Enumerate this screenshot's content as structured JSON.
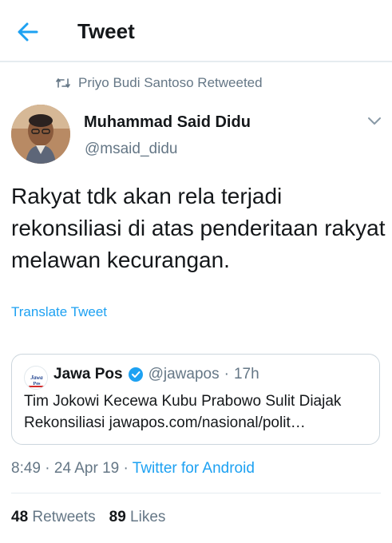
{
  "header": {
    "title": "Tweet"
  },
  "retweet": {
    "text": "Priyo Budi Santoso Retweeted"
  },
  "author": {
    "name": "Muhammad Said Didu",
    "handle": "@msaid_didu"
  },
  "tweet": {
    "text": "Rakyat tdk akan rela terjadi rekonsiliasi di atas penderitaan rakyat melawan kecurangan.",
    "translate_label": "Translate Tweet"
  },
  "quote": {
    "name": "Jawa Pos",
    "handle": "@jawapos",
    "separator": "·",
    "time": "17h",
    "line1": "Tim Jokowi Kecewa Kubu Prabowo Sulit Diajak",
    "line2": "Rekonsiliasi jawapos.com/nasional/polit…",
    "logo_text": "Jawa Pos"
  },
  "meta": {
    "time": "8:49",
    "sep1": "·",
    "date": "24 Apr 19",
    "sep2": "·",
    "source": "Twitter for Android"
  },
  "stats": {
    "retweets_count": "48",
    "retweets_label": "Retweets",
    "likes_count": "89",
    "likes_label": "Likes"
  },
  "colors": {
    "accent": "#1da1f2",
    "secondary_text": "#657786",
    "border": "#e6ecf0",
    "verified": "#1da1f2"
  },
  "icons": {
    "back": "arrow-left-icon",
    "retweet": "retweet-icon",
    "caret": "chevron-down-icon",
    "verified": "verified-badge-icon"
  }
}
